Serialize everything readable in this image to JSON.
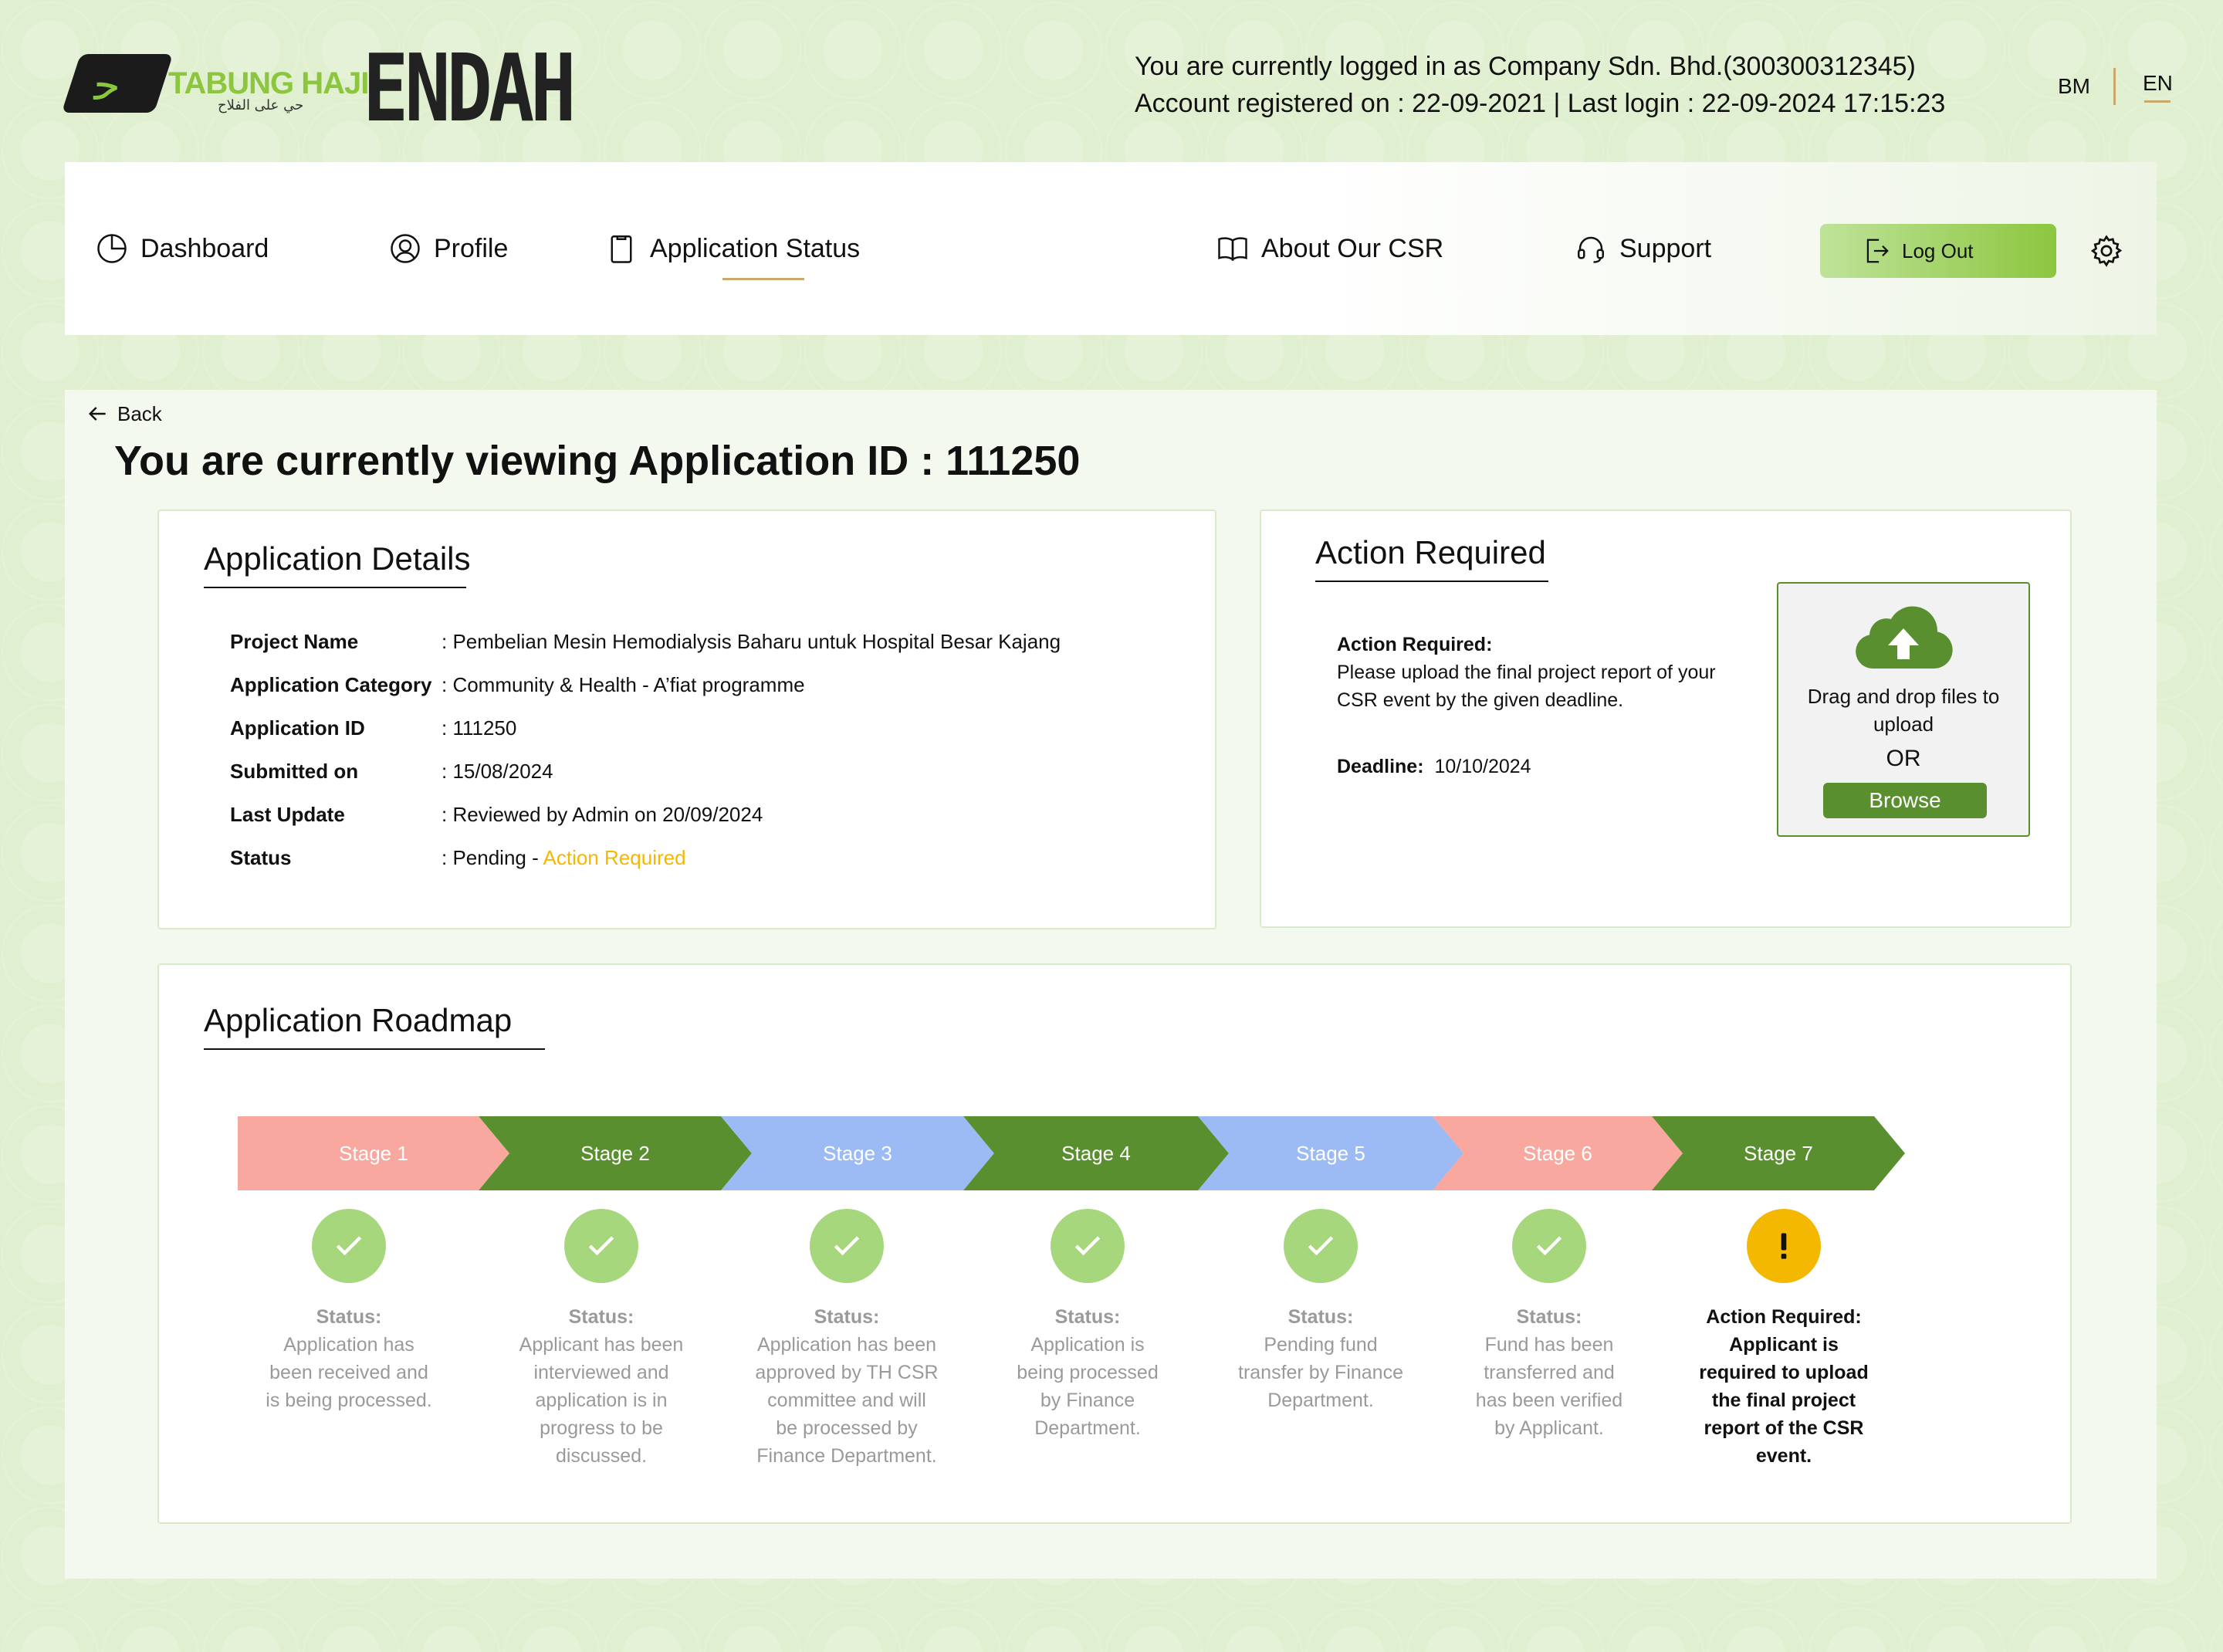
{
  "header": {
    "logo_text": "TABUNG HAJI",
    "logo_subtext": "حي على الفلاح",
    "brand": "ENDAH",
    "login_line1": "You are currently logged in as Company Sdn. Bhd.(300300312345)",
    "login_line2": "Account registered on : 22-09-2021 | Last login : 22-09-2024 17:15:23",
    "lang_bm": "BM",
    "lang_en": "EN"
  },
  "nav": {
    "dashboard": "Dashboard",
    "profile": "Profile",
    "application_status": "Application Status",
    "about": "About Our CSR",
    "support": "Support",
    "logout": "Log Out",
    "active": "Application Status"
  },
  "page": {
    "back": "Back",
    "title": "You are currently viewing Application ID :  111250"
  },
  "details": {
    "title": "Application Details",
    "rows": [
      {
        "label": "Project Name",
        "value": ": Pembelian Mesin Hemodialysis Baharu untuk Hospital Besar Kajang"
      },
      {
        "label": "Application Category",
        "value": ": Community & Health - A’fiat programme"
      },
      {
        "label": "Application ID",
        "value": ": 111250"
      },
      {
        "label": "Submitted on",
        "value": ": 15/08/2024"
      },
      {
        "label": "Last Update",
        "value": ": Reviewed by Admin on 20/09/2024"
      },
      {
        "label": "Status",
        "value": ": Pending - ",
        "highlight": "Action Required"
      }
    ]
  },
  "action": {
    "title": "Action Required",
    "label": "Action Required:",
    "text1": "Please upload the final project report of your",
    "text2": "CSR event by the given deadline.",
    "deadline_label": "Deadline:",
    "deadline_value": "10/10/2024",
    "upload_line1": "Drag and drop files to",
    "upload_line2": "upload",
    "or": "OR",
    "browse": "Browse"
  },
  "roadmap": {
    "title": "Application Roadmap",
    "stages": [
      {
        "label": "Stage 1",
        "color": "#f9a8a0",
        "state": "done",
        "status_label": "Status:",
        "lines": [
          "Application has",
          "been received and",
          "is being processed."
        ]
      },
      {
        "label": "Stage 2",
        "color": "#5a8f2f",
        "state": "done",
        "status_label": "Status:",
        "lines": [
          "Applicant has been",
          "interviewed and",
          "application is in",
          "progress to be",
          "discussed."
        ]
      },
      {
        "label": "Stage 3",
        "color": "#9cbbf5",
        "state": "done",
        "status_label": "Status:",
        "lines": [
          "Application has been",
          "approved by TH CSR",
          "committee and will",
          "be processed by",
          "Finance Department."
        ]
      },
      {
        "label": "Stage 4",
        "color": "#5a8f2f",
        "state": "done",
        "status_label": "Status:",
        "lines": [
          "Application is",
          "being processed",
          "by Finance",
          "Department."
        ]
      },
      {
        "label": "Stage 5",
        "color": "#9cbbf5",
        "state": "done",
        "status_label": "Status:",
        "lines": [
          "Pending fund",
          "transfer by Finance",
          "Department."
        ]
      },
      {
        "label": "Stage 6",
        "color": "#f9a8a0",
        "state": "done",
        "status_label": "Status:",
        "lines": [
          "Fund has been",
          "transferred and",
          "has been verified",
          "by Applicant."
        ]
      },
      {
        "label": "Stage 7",
        "color": "#5a8f2f",
        "state": "action",
        "status_label": "Action Required:",
        "lines": [
          "Applicant is",
          "required to upload",
          "the final project",
          "report of the CSR",
          "event."
        ]
      }
    ]
  },
  "colors": {
    "brand_green": "#8cc63f",
    "dark_green": "#5a8f2f",
    "check_green": "#a7d77c",
    "amber": "#f5b800",
    "gold_underline": "#c8a96a"
  }
}
